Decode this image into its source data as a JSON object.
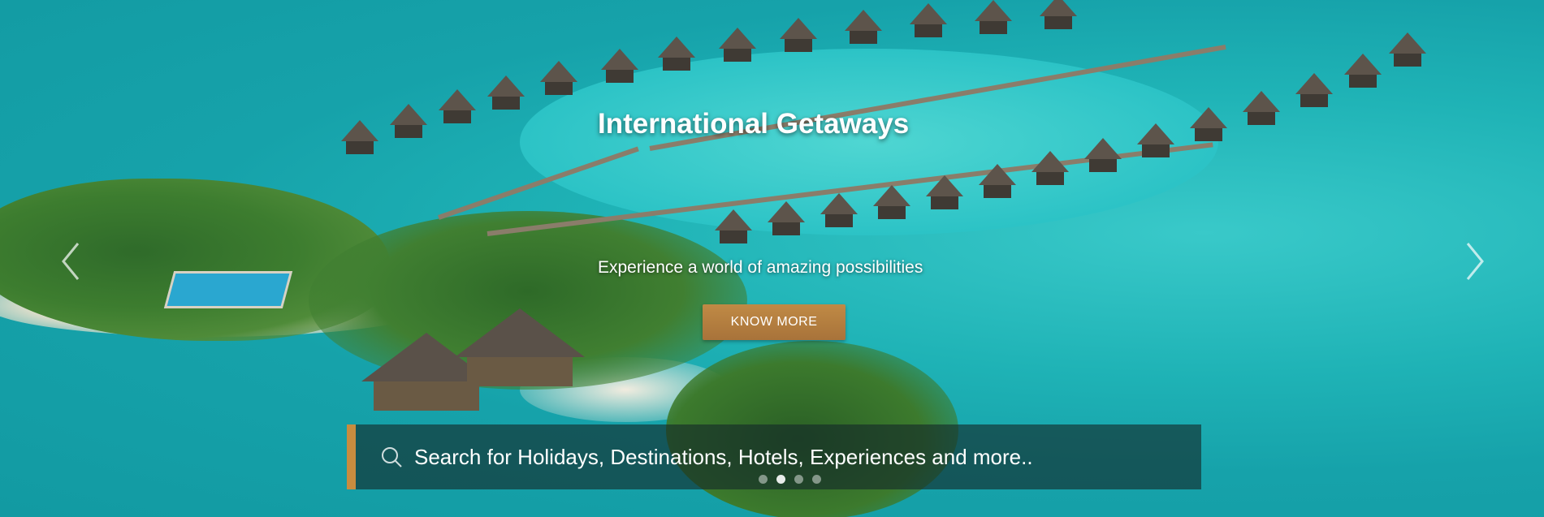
{
  "hero": {
    "title": "International Getaways",
    "subtitle": "Experience a world of amazing possibilities",
    "cta_label": "KNOW MORE"
  },
  "search": {
    "placeholder": "Search for Holidays,  Destinations, Hotels, Experiences and more.."
  },
  "carousel": {
    "slide_count": 4,
    "active_slide": 2,
    "prev_icon": "chevron-left-icon",
    "next_icon": "chevron-right-icon"
  },
  "colors": {
    "accent": "#c88c3f",
    "cta": "#b07a3d",
    "water": "#1fb3b6"
  }
}
